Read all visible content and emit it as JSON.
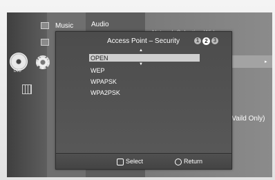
{
  "menu": {
    "category_music": "Music",
    "category_audio": "Audio",
    "dvd_label": "DVD",
    "bg_truncated_right": "Network Selection Wirless",
    "bg_vaild_only": "(Vaild Only)"
  },
  "popup": {
    "title": "Access Point – Security",
    "steps": [
      "1",
      "2",
      "3"
    ],
    "active_step": 2,
    "options": [
      "OPEN",
      "WEP",
      "WPAPSK",
      "WPA2PSK"
    ],
    "selected_option": "OPEN"
  },
  "footer": {
    "select_label": "Select",
    "return_label": "Return"
  },
  "colors": {
    "popup_bg": "#4c4c4c",
    "selected_row_bg": "#cfcfcf",
    "text": "#ffffff"
  }
}
